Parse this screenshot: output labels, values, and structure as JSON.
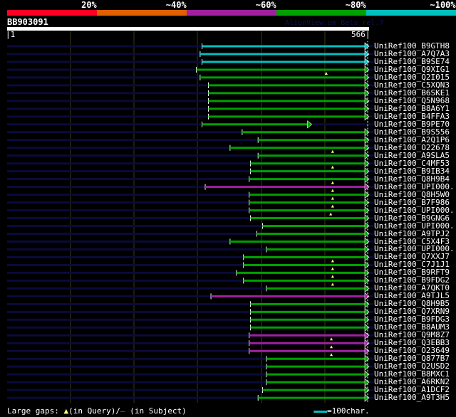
{
  "color_key": [
    {
      "label": "20%",
      "color": "#ff0022"
    },
    {
      "label": "~40%",
      "color": "#e06000"
    },
    {
      "label": "~60%",
      "color": "#a020a0"
    },
    {
      "label": "~80%",
      "color": "#00a000"
    },
    {
      "label": "~100%",
      "color": "#00c0c0"
    }
  ],
  "query": {
    "name": "BB903091",
    "start_label": "|1",
    "end_label": "566|",
    "length": 566
  },
  "watermark": "AlignView.pm Beta rel.7",
  "footer": {
    "gaps_label": "Large gaps:",
    "in_query": "(in Query)/",
    "in_subject": "(in Subject)",
    "scale_label": "=100char."
  },
  "hits": [
    {
      "name": "UniRef100_B9GTH8",
      "color": "#00c0c0",
      "start": 306,
      "end": 566,
      "gaps": []
    },
    {
      "name": "UniRef100_A7Q7A3",
      "color": "#00c0c0",
      "start": 303,
      "end": 566,
      "gaps": []
    },
    {
      "name": "UniRef100_B9SE74",
      "color": "#00c0c0",
      "start": 306,
      "end": 566,
      "gaps": []
    },
    {
      "name": "UniRef100_Q9XIG1",
      "color": "#00a000",
      "start": 297,
      "end": 566,
      "gaps": [
        501
      ]
    },
    {
      "name": "UniRef100_Q2I015",
      "color": "#00a000",
      "start": 303,
      "end": 566,
      "gaps": []
    },
    {
      "name": "UniRef100_C5XQN3",
      "color": "#00a000",
      "start": 316,
      "end": 566,
      "gaps": []
    },
    {
      "name": "UniRef100_B6SKE1",
      "color": "#00a000",
      "start": 316,
      "end": 566,
      "gaps": []
    },
    {
      "name": "UniRef100_Q5N968",
      "color": "#00a000",
      "start": 316,
      "end": 566,
      "gaps": []
    },
    {
      "name": "UniRef100_B8A6Y1",
      "color": "#00a000",
      "start": 316,
      "end": 566,
      "gaps": []
    },
    {
      "name": "UniRef100_B4FFA3",
      "color": "#00a000",
      "start": 316,
      "end": 566,
      "gaps": []
    },
    {
      "name": "UniRef100_B9PE70",
      "color": "#00a000",
      "start": 306,
      "end": 476,
      "gaps": []
    },
    {
      "name": "UniRef100_B9S556",
      "color": "#00a000",
      "start": 369,
      "end": 566,
      "gaps": []
    },
    {
      "name": "UniRef100_A2Q1P6",
      "color": "#00a000",
      "start": 394,
      "end": 566,
      "gaps": []
    },
    {
      "name": "UniRef100_O22678",
      "color": "#00a000",
      "start": 350,
      "end": 566,
      "gaps": [
        511
      ]
    },
    {
      "name": "UniRef100_A9SLA5",
      "color": "#00a000",
      "start": 394,
      "end": 566,
      "gaps": []
    },
    {
      "name": "UniRef100_C4MF53",
      "color": "#00a000",
      "start": 382,
      "end": 566,
      "gaps": [
        511
      ]
    },
    {
      "name": "UniRef100_B9IB34",
      "color": "#00a000",
      "start": 382,
      "end": 566,
      "gaps": []
    },
    {
      "name": "UniRef100_Q8H9B4",
      "color": "#00a000",
      "start": 380,
      "end": 566,
      "gaps": [
        511
      ]
    },
    {
      "name": "UniRef100_UPI000..",
      "color": "#a020a0",
      "start": 311,
      "end": 566,
      "gaps": [
        511
      ]
    },
    {
      "name": "UniRef100_Q8H5W0",
      "color": "#00a000",
      "start": 380,
      "end": 566,
      "gaps": [
        511
      ]
    },
    {
      "name": "UniRef100_B7F986",
      "color": "#00a000",
      "start": 380,
      "end": 566,
      "gaps": [
        511
      ]
    },
    {
      "name": "UniRef100_UPI000..",
      "color": "#00a000",
      "start": 380,
      "end": 566,
      "gaps": [
        508
      ]
    },
    {
      "name": "UniRef100_B9GNG6",
      "color": "#00a000",
      "start": 382,
      "end": 566,
      "gaps": []
    },
    {
      "name": "UniRef100_UPI000..",
      "color": "#00a000",
      "start": 401,
      "end": 566,
      "gaps": []
    },
    {
      "name": "UniRef100_A9TPJ2",
      "color": "#00a000",
      "start": 392,
      "end": 566,
      "gaps": []
    },
    {
      "name": "UniRef100_C5X4F3",
      "color": "#00a000",
      "start": 350,
      "end": 566,
      "gaps": []
    },
    {
      "name": "UniRef100_UPI000..",
      "color": "#00a000",
      "start": 407,
      "end": 566,
      "gaps": []
    },
    {
      "name": "UniRef100_Q7XXJ7",
      "color": "#00a000",
      "start": 371,
      "end": 566,
      "gaps": [
        511
      ]
    },
    {
      "name": "UniRef100_C7J1J1",
      "color": "#00a000",
      "start": 371,
      "end": 566,
      "gaps": [
        511
      ]
    },
    {
      "name": "UniRef100_B9RFT9",
      "color": "#00a000",
      "start": 360,
      "end": 566,
      "gaps": [
        511
      ]
    },
    {
      "name": "UniRef100_B9FDG2",
      "color": "#00a000",
      "start": 371,
      "end": 566,
      "gaps": [
        511
      ]
    },
    {
      "name": "UniRef100_A7QKT0",
      "color": "#00a000",
      "start": 407,
      "end": 566,
      "gaps": []
    },
    {
      "name": "UniRef100_A9TJL5",
      "color": "#a020a0",
      "start": 320,
      "end": 566,
      "gaps": []
    },
    {
      "name": "UniRef100_Q8H9B5",
      "color": "#00a000",
      "start": 382,
      "end": 566,
      "gaps": []
    },
    {
      "name": "UniRef100_Q7XRN9",
      "color": "#00a000",
      "start": 382,
      "end": 566,
      "gaps": []
    },
    {
      "name": "UniRef100_B9FDG3",
      "color": "#00a000",
      "start": 382,
      "end": 566,
      "gaps": []
    },
    {
      "name": "UniRef100_B8AUM3",
      "color": "#00a000",
      "start": 382,
      "end": 566,
      "gaps": []
    },
    {
      "name": "UniRef100_Q9M8Z7",
      "color": "#a020a0",
      "start": 380,
      "end": 566,
      "gaps": [
        509
      ]
    },
    {
      "name": "UniRef100_Q3EBB3",
      "color": "#a020a0",
      "start": 380,
      "end": 566,
      "gaps": [
        509
      ]
    },
    {
      "name": "UniRef100_O23649",
      "color": "#a020a0",
      "start": 380,
      "end": 566,
      "gaps": [
        509
      ]
    },
    {
      "name": "UniRef100_Q877B7",
      "color": "#00a000",
      "start": 407,
      "end": 566,
      "gaps": []
    },
    {
      "name": "UniRef100_Q2USD2",
      "color": "#00a000",
      "start": 407,
      "end": 566,
      "gaps": []
    },
    {
      "name": "UniRef100_B8MXC1",
      "color": "#00a000",
      "start": 407,
      "end": 566,
      "gaps": []
    },
    {
      "name": "UniRef100_A6RKN2",
      "color": "#00a000",
      "start": 407,
      "end": 566,
      "gaps": []
    },
    {
      "name": "UniRef100_A1DCF2",
      "color": "#00a000",
      "start": 401,
      "end": 566,
      "gaps": []
    },
    {
      "name": "UniRef100_A9T3H5",
      "color": "#00a000",
      "start": 394,
      "end": 566,
      "gaps": []
    }
  ]
}
